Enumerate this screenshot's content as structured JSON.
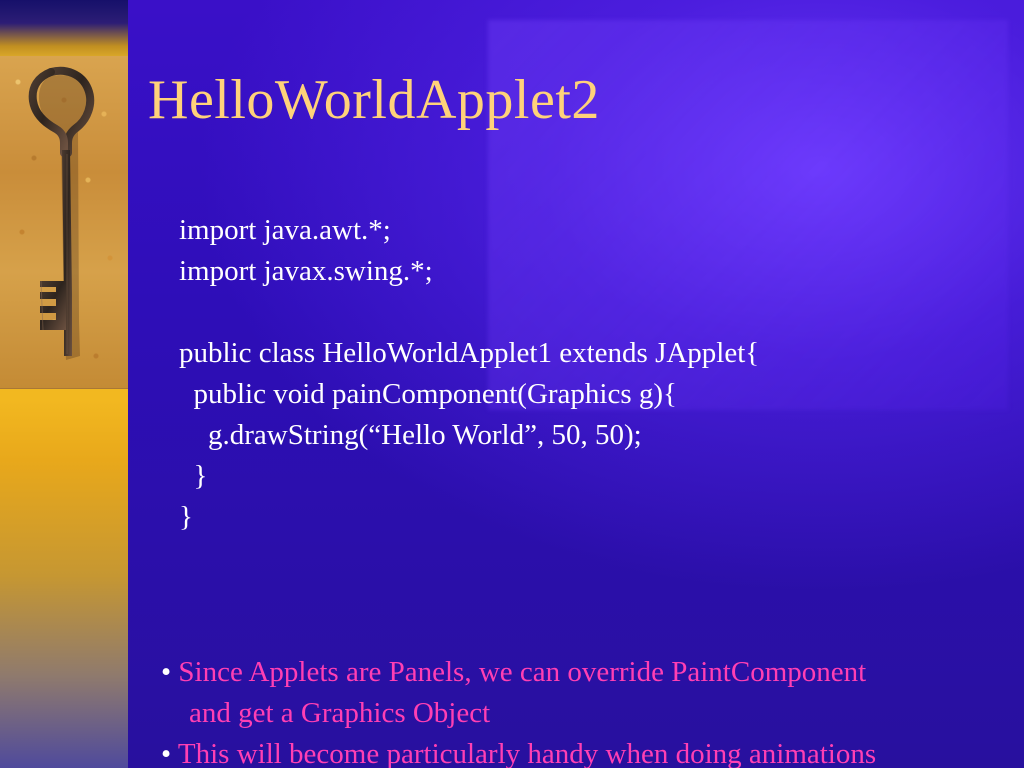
{
  "slide": {
    "title": "HelloWorldApplet2",
    "code": [
      "import java.awt.*;",
      "import javax.swing.*;",
      "",
      "public class HelloWorldApplet1 extends JApplet{",
      "  public void painComponent(Graphics g){",
      "    g.drawString(“Hello World”, 50, 50);",
      "  }",
      "}"
    ],
    "bullets": [
      {
        "dot": "•",
        "text": "Since Applets are Panels, we can override PaintComponent",
        "continuation": "and get a Graphics Object"
      },
      {
        "dot": "•",
        "text": "This will become particularly handy when doing animations"
      }
    ]
  },
  "theme": {
    "title_color": "#ffd27a",
    "code_color": "#ffffff",
    "bullet_color": "#ff3fb3"
  }
}
